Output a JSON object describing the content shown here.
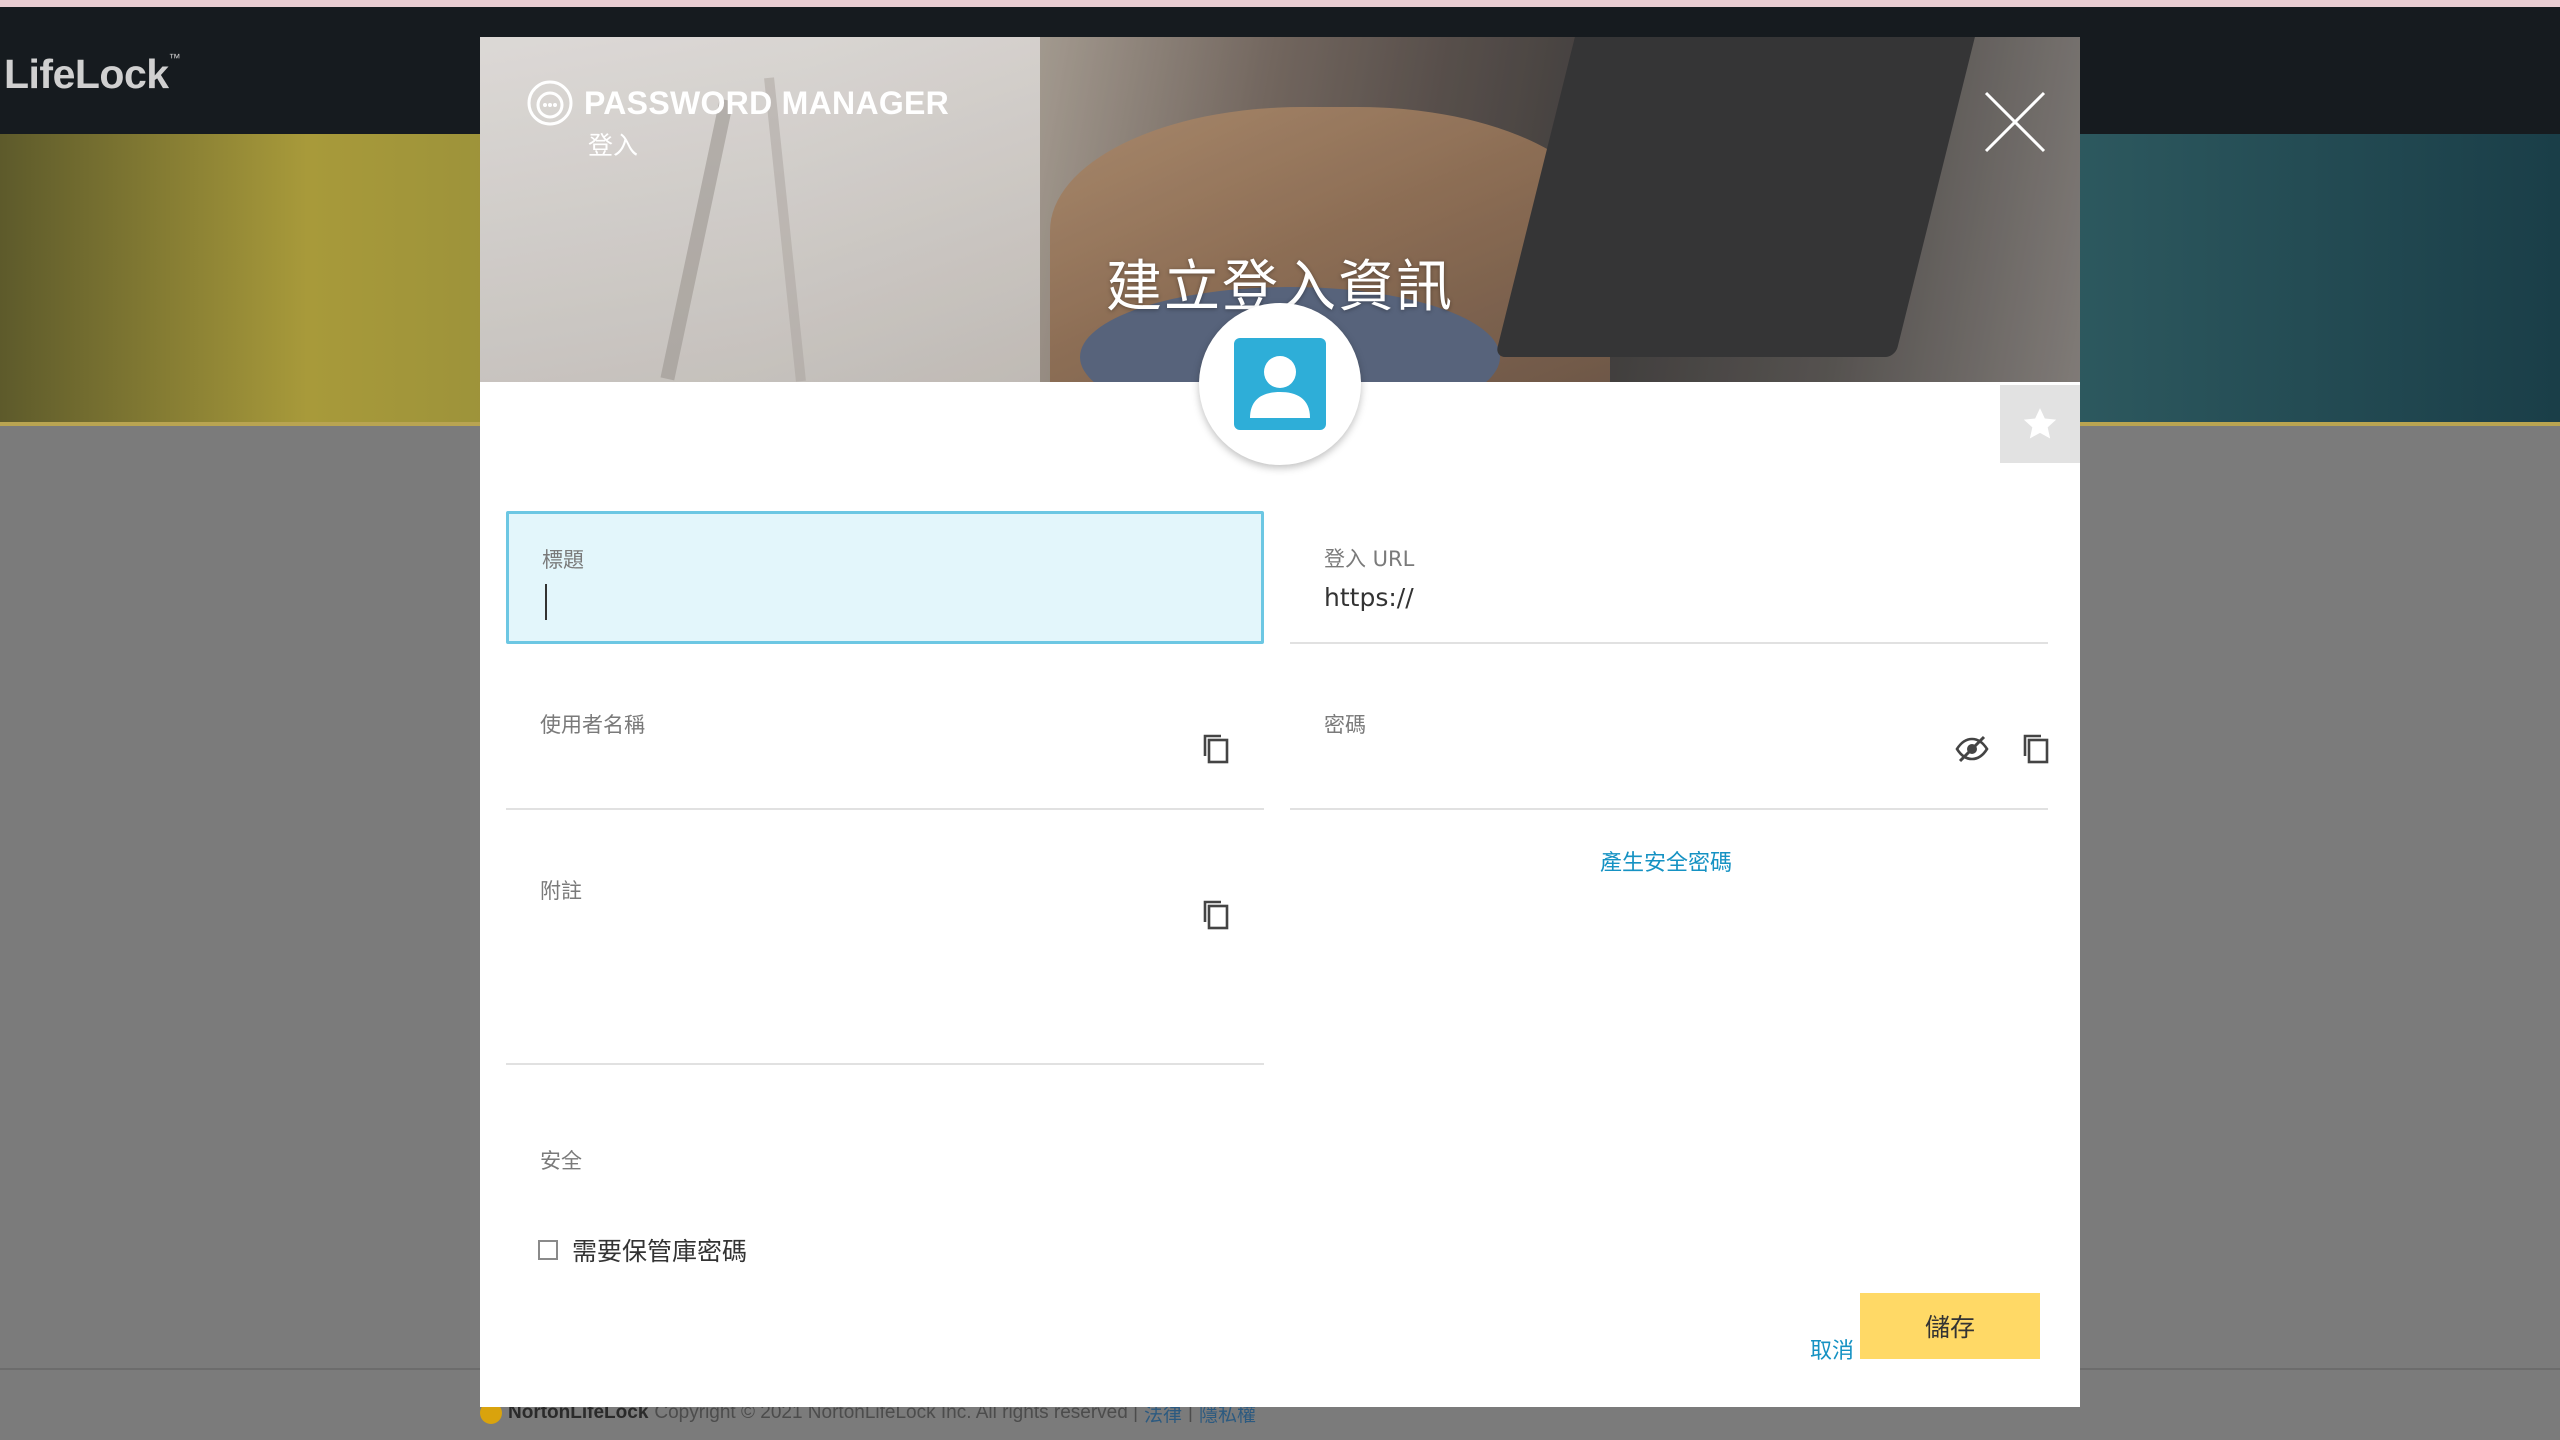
{
  "background": {
    "brand": "LifeLock",
    "brand_tm": "™",
    "footer_brand": "NortonLifeLock",
    "footer_copyright": "Copyright © 2021 NortonLifeLock Inc. All rights reserved |",
    "footer_link_legal": "法律",
    "footer_sep": "|",
    "footer_link_privacy": "隱私權"
  },
  "modal": {
    "app_name": "PASSWORD MANAGER",
    "section": "登入",
    "title": "建立登入資訊",
    "fields": {
      "title": {
        "label": "標題",
        "value": ""
      },
      "url": {
        "label": "登入 URL",
        "value": "https://"
      },
      "username": {
        "label": "使用者名稱",
        "value": ""
      },
      "password": {
        "label": "密碼",
        "value": ""
      },
      "notes": {
        "label": "附註",
        "value": ""
      }
    },
    "generate_password_link": "產生安全密碼",
    "security": {
      "label": "安全",
      "require_vault_password_label": "需要保管庫密碼",
      "require_vault_password_checked": false
    },
    "cancel_label": "取消",
    "save_label": "儲存"
  },
  "colors": {
    "accent_blue": "#1592c3",
    "avatar_blue": "#2eaed8",
    "save_yellow": "#ffd966",
    "focus_field_bg": "#e3f6fb"
  }
}
